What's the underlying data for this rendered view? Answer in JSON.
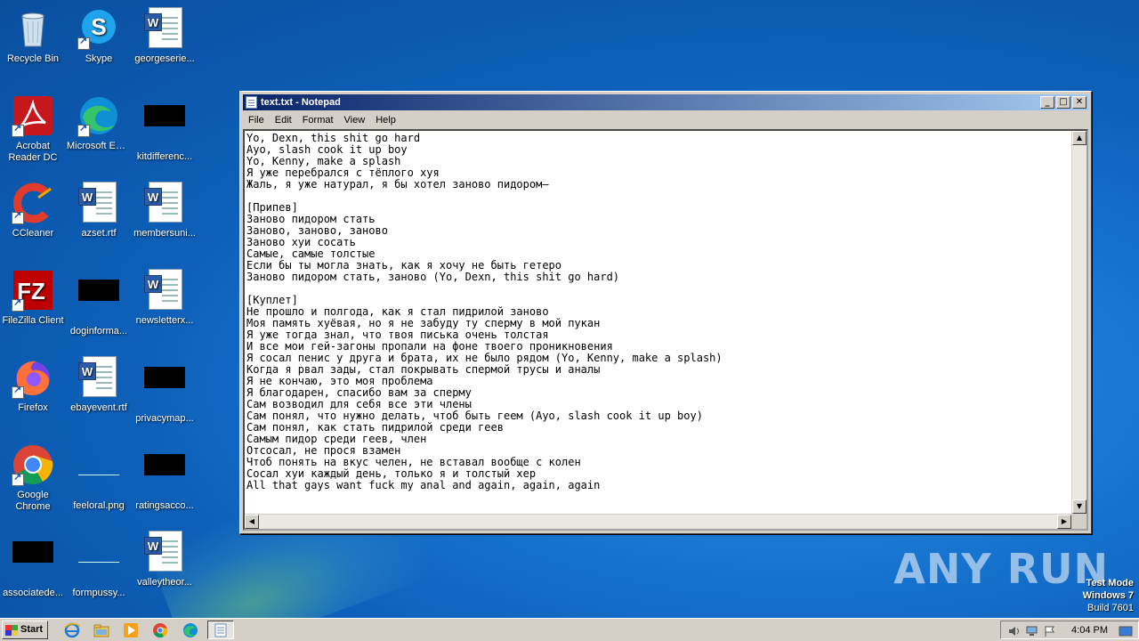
{
  "desktop": {
    "icons": [
      {
        "label": "Recycle Bin",
        "icon": "recycle-bin-icon"
      },
      {
        "label": "Skype",
        "icon": "skype-icon"
      },
      {
        "label": "georgeserie...",
        "icon": "word-document-icon"
      },
      {
        "label": "Acrobat Reader DC",
        "icon": "acrobat-reader-icon"
      },
      {
        "label": "Microsoft Edge",
        "icon": "edge-icon"
      },
      {
        "label": "kitdifferenc...",
        "icon": "black-thumbnail-icon"
      },
      {
        "label": "CCleaner",
        "icon": "ccleaner-icon"
      },
      {
        "label": "azset.rtf",
        "icon": "word-document-icon"
      },
      {
        "label": "membersuni...",
        "icon": "word-document-icon"
      },
      {
        "label": "FileZilla Client",
        "icon": "filezilla-icon"
      },
      {
        "label": "doginforma...",
        "icon": "black-thumbnail-icon"
      },
      {
        "label": "newsletterx...",
        "icon": "word-document-icon"
      },
      {
        "label": "Firefox",
        "icon": "firefox-icon"
      },
      {
        "label": "ebayevent.rtf",
        "icon": "word-document-icon"
      },
      {
        "label": "privacymap...",
        "icon": "black-thumbnail-icon"
      },
      {
        "label": "Google Chrome",
        "icon": "chrome-icon"
      },
      {
        "label": "feeloral.png",
        "icon": "image-thumbnail-icon"
      },
      {
        "label": "ratingsacco...",
        "icon": "black-thumbnail-icon"
      },
      {
        "label": "associatede...",
        "icon": "black-thumbnail-icon"
      },
      {
        "label": "formpussy...",
        "icon": "image-thumbnail-icon"
      },
      {
        "label": "valleytheor...",
        "icon": "word-document-icon"
      }
    ]
  },
  "notepad": {
    "title": "text.txt - Notepad",
    "menu": [
      "File",
      "Edit",
      "Format",
      "View",
      "Help"
    ],
    "content": "Yo, Dexn, this shit go hard\nAyo, slash cook it up boy\nYo, Kenny, make a splash\nЯ уже перебрался с тёплого хуя\nЖаль, я уже натурал, я бы хотел заново пидором—\n\n[Припев]\nЗаново пидором стать\nЗаново, заново, заново\nЗаново хуи сосать\nСамые, самые толстые\nЕсли бы ты могла знать, как я хочу не быть гетеро\nЗаново пидором стать, заново (Yo, Dexn, this shit go hard)\n\n[Куплет]\nНе прошло и полгода, как я стал пидрилой заново\nМоя память хуёвая, но я не забуду ту сперму в мой пукан\nЯ уже тогда знал, что твоя писька очень толстая\nИ все мои гей-загоны пропали на фоне твоего проникновения\nЯ сосал пенис у друга и брата, их не было рядом (Yo, Kenny, make a splash)\nКогда я рвал зады, стал покрывать спермой трусы и аналы\nЯ не кончаю, это моя проблема\nЯ благодарен, спасибо вам за сперму\nСам возводил для себя все эти члены\nСам понял, что нужно делать, чтоб быть геем (Ayo, slash cook it up boy)\nСам понял, как стать пидрилой среди геев\nСамым пидор среди геев, член\nОтсосал, не прося взамен\nЧтоб понять на вкус челен, не вставал вообще с колен\nСосал хуи каждый день, только я и толстый хер\nAll that gays want fuck my anal and again, again, again"
  },
  "watermark": {
    "text": "ANY RUN"
  },
  "testmode": {
    "line1": "Test Mode",
    "line2": "Windows 7",
    "line3": "Build 7601"
  },
  "taskbar": {
    "start_label": "Start",
    "clock": "4:04 PM",
    "pinned": [
      "ie-icon",
      "explorer-icon",
      "media-player-icon",
      "chrome-icon",
      "edge-icon",
      "notepad-icon"
    ]
  }
}
